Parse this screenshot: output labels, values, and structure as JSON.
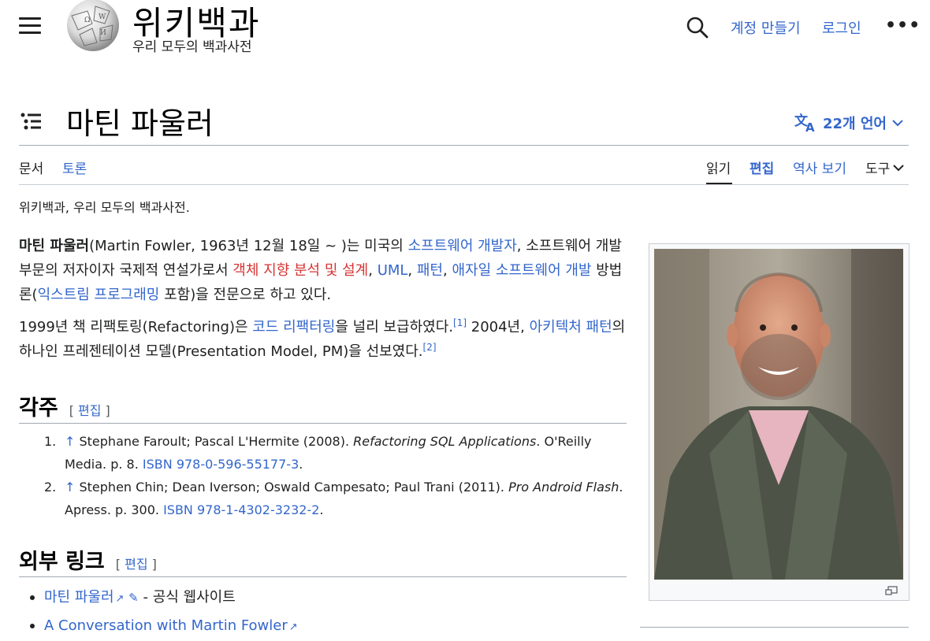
{
  "header": {
    "wordmark": "위키백과",
    "tagline": "우리 모두의 백과사전",
    "create_account": "계정 만들기",
    "login": "로그인",
    "more": "•••"
  },
  "title": {
    "text": "마틴 파울러",
    "languages": "22개 언어"
  },
  "tabs": {
    "article": "문서",
    "talk": "토론",
    "read": "읽기",
    "edit": "편집",
    "history": "역사 보기",
    "tools": "도구"
  },
  "site_sub": "위키백과, 우리 모두의 백과사전.",
  "intro": {
    "bold_name": "마틴 파울러",
    "t1": "(Martin Fowler, 1963년 12월 18일 ~ )는 미국의 ",
    "link_software_dev": "소프트웨어 개발자",
    "t2": ", 소프트웨어 개발 부문의 저자이자 국제적 연설가로서 ",
    "link_ooad": "객체 지향 분석 및 설계",
    "t3": ", ",
    "link_uml": "UML",
    "t4": ", ",
    "link_pattern": "패턴",
    "t5": ", ",
    "link_agile": "애자일 소프트웨어 개발",
    "t6": " 방법론(",
    "link_xp": "익스트림 프로그래밍",
    "t7": " 포함)을 전문으로 하고 있다."
  },
  "para2": {
    "t1": "1999년 책 리팩토링(Refactoring)은 ",
    "link_refactoring": "코드 리팩터링",
    "t2": "을 널리 보급하였다.",
    "ref1": "[1]",
    "t3": " 2004년, ",
    "link_arch": "아키텍처 패턴",
    "t4": "의 하나인 프레젠테이션 모델(Presentation Model, PM)을 선보였다.",
    "ref2": "[2]"
  },
  "references": {
    "heading": "각주",
    "edit": "편집",
    "items": [
      {
        "num": "1.",
        "arrow": "↑",
        "authors": "Stephane Faroult; Pascal L'Hermite (2008). ",
        "title": "Refactoring SQL Applications",
        "rest": ". O'Reilly Media. p. 8. ",
        "isbn": "ISBN 978-0-596-55177-3",
        "end": "."
      },
      {
        "num": "2.",
        "arrow": "↑",
        "authors": "Stephen Chin; Dean Iverson; Oswald Campesato; Paul Trani (2011). ",
        "title": "Pro Android Flash",
        "rest": ". Apress. p. 300. ",
        "isbn": "ISBN 978-1-4302-3232-2",
        "end": "."
      }
    ]
  },
  "external": {
    "heading": "외부 링크",
    "edit": "편집",
    "items": [
      {
        "link": "마틴 파울러",
        "suffix": " - 공식 웹사이트"
      },
      {
        "link": "A Conversation with Martin Fowler",
        "suffix": ""
      }
    ]
  },
  "colors": {
    "link": "#3366cc",
    "redlink": "#d73333",
    "text": "#202122"
  }
}
